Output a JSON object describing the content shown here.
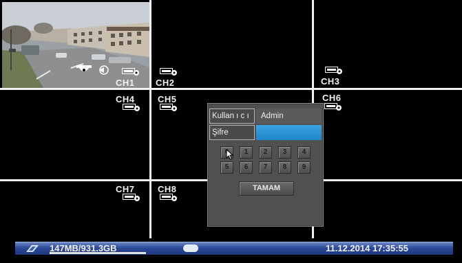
{
  "channels": [
    "CH1",
    "CH2",
    "CH3",
    "CH4",
    "CH5",
    "CH6",
    "CH7",
    "CH8"
  ],
  "icons": {
    "camera": "camera-record-icon",
    "dome": "dome-camera-icon",
    "motion": "motion-detect-icon",
    "cursor": "mouse-pointer-icon",
    "brand": "brand-logo-icon",
    "hdd": "hdd-icon"
  },
  "login": {
    "user_label": "Kullan ı c ı",
    "user_value": "Admin",
    "password_label": "Şifre",
    "password_value": "",
    "keys": [
      "0",
      "1",
      "2",
      "3",
      "4",
      "5",
      "6",
      "7",
      "8",
      "9"
    ],
    "ok_label": "TAMAM"
  },
  "status": {
    "disk_usage": "147MB/931.3GB",
    "disk_fraction": 0.0002,
    "datetime": "11.12.2014 17:35:55"
  },
  "colors": {
    "grid": "#f2f2f2",
    "statusbar": "#2b4a9a",
    "password_field": "#1f86c9"
  }
}
